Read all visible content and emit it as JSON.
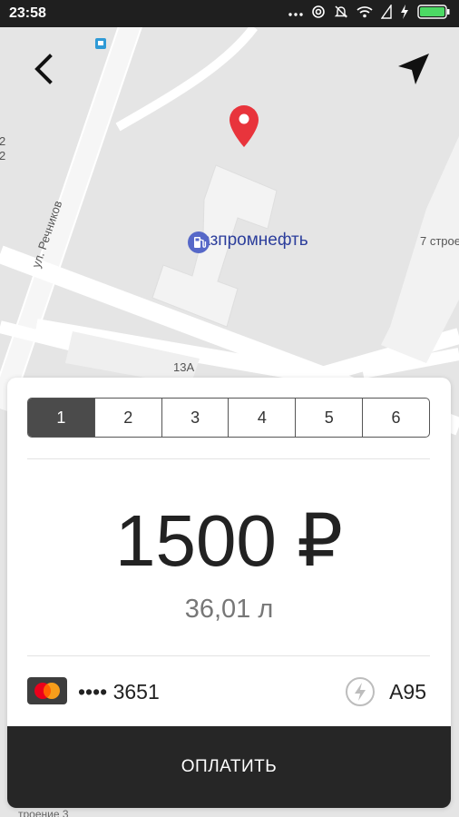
{
  "status_bar": {
    "time": "23:58",
    "icons": [
      "more-dots-icon",
      "hotspot-icon",
      "mute-icon",
      "wifi-icon",
      "sim-icon",
      "charging-icon",
      "battery-icon"
    ],
    "battery_color": "#4cd964"
  },
  "map": {
    "street_label": "ул. Речников",
    "building_label_13a": "13А",
    "building_label_7": "7 строе",
    "building_label_side": "2",
    "building_label_side2": "2",
    "bottom_partial_label": "троение 3",
    "poi_name": "Газпромнефть",
    "poi_color": "#2c3e9c",
    "pin_color": "#e8343c"
  },
  "header": {
    "back_icon": "chevron-left-icon",
    "locate_icon": "navigation-arrow-icon"
  },
  "payment": {
    "columns": [
      {
        "label": "1",
        "active": true
      },
      {
        "label": "2",
        "active": false
      },
      {
        "label": "3",
        "active": false
      },
      {
        "label": "4",
        "active": false
      },
      {
        "label": "5",
        "active": false
      },
      {
        "label": "6",
        "active": false
      }
    ],
    "amount": "1500 ₽",
    "liters": "36,01 л",
    "card_number": "•••• 3651",
    "card_brand_icon": "mastercard-icon",
    "fuel_icon": "lightning-icon",
    "fuel_type": "А95",
    "pay_label": "ОПЛАТИТЬ"
  }
}
